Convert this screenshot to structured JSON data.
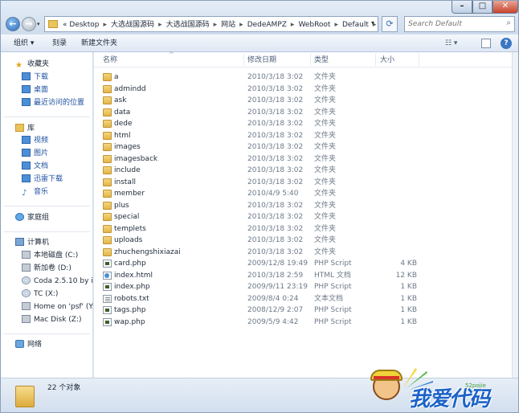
{
  "address": {
    "crumbs": [
      "«",
      "Desktop",
      "大选战国源码",
      "大选战国源码",
      "网站",
      "DedeAMPZ",
      "WebRoot",
      "Default"
    ],
    "search_placeholder": "Search Default"
  },
  "toolbar": {
    "organize": "组织 ▾",
    "burn": "刻录",
    "new_folder": "新建文件夹"
  },
  "nav": {
    "favorites": "收藏夹",
    "fav_items": [
      "下载",
      "桌面",
      "最近访问的位置"
    ],
    "libraries": "库",
    "lib_items": [
      "视频",
      "图片",
      "文档",
      "迅雷下载",
      "音乐"
    ],
    "homegroup": "家庭组",
    "computer": "计算机",
    "computer_items": [
      "本地磁盘 (C:)",
      "新加卷 (D:)",
      "Coda 2.5.10 by itsu",
      "TC (X:)",
      "Home on 'psf' (Y:)",
      "Mac Disk (Z:)"
    ],
    "network": "网络"
  },
  "columns": {
    "name": "名称",
    "date": "修改日期",
    "type": "类型",
    "size": "大小"
  },
  "files": [
    {
      "name": "a",
      "date": "2010/3/18 3:02",
      "type": "文件夹",
      "size": "",
      "icon": "folder"
    },
    {
      "name": "admindd",
      "date": "2010/3/18 3:02",
      "type": "文件夹",
      "size": "",
      "icon": "folder"
    },
    {
      "name": "ask",
      "date": "2010/3/18 3:02",
      "type": "文件夹",
      "size": "",
      "icon": "folder"
    },
    {
      "name": "data",
      "date": "2010/3/18 3:02",
      "type": "文件夹",
      "size": "",
      "icon": "folder"
    },
    {
      "name": "dede",
      "date": "2010/3/18 3:02",
      "type": "文件夹",
      "size": "",
      "icon": "folder"
    },
    {
      "name": "html",
      "date": "2010/3/18 3:02",
      "type": "文件夹",
      "size": "",
      "icon": "folder"
    },
    {
      "name": "images",
      "date": "2010/3/18 3:02",
      "type": "文件夹",
      "size": "",
      "icon": "folder"
    },
    {
      "name": "imagesback",
      "date": "2010/3/18 3:02",
      "type": "文件夹",
      "size": "",
      "icon": "folder"
    },
    {
      "name": "include",
      "date": "2010/3/18 3:02",
      "type": "文件夹",
      "size": "",
      "icon": "folder"
    },
    {
      "name": "install",
      "date": "2010/3/18 3:02",
      "type": "文件夹",
      "size": "",
      "icon": "folder"
    },
    {
      "name": "member",
      "date": "2010/4/9 5:40",
      "type": "文件夹",
      "size": "",
      "icon": "folder"
    },
    {
      "name": "plus",
      "date": "2010/3/18 3:02",
      "type": "文件夹",
      "size": "",
      "icon": "folder"
    },
    {
      "name": "special",
      "date": "2010/3/18 3:02",
      "type": "文件夹",
      "size": "",
      "icon": "folder"
    },
    {
      "name": "templets",
      "date": "2010/3/18 3:02",
      "type": "文件夹",
      "size": "",
      "icon": "folder"
    },
    {
      "name": "uploads",
      "date": "2010/3/18 3:02",
      "type": "文件夹",
      "size": "",
      "icon": "folder"
    },
    {
      "name": "zhuchengshixiazai",
      "date": "2010/3/18 3:02",
      "type": "文件夹",
      "size": "",
      "icon": "folder"
    },
    {
      "name": "card.php",
      "date": "2009/12/8 19:49",
      "type": "PHP Script",
      "size": "4 KB",
      "icon": "php"
    },
    {
      "name": "index.html",
      "date": "2010/3/18 2:59",
      "type": "HTML 文档",
      "size": "12 KB",
      "icon": "html"
    },
    {
      "name": "index.php",
      "date": "2009/9/11 23:19",
      "type": "PHP Script",
      "size": "1 KB",
      "icon": "php"
    },
    {
      "name": "robots.txt",
      "date": "2009/8/4 0:24",
      "type": "文本文档",
      "size": "1 KB",
      "icon": "txt"
    },
    {
      "name": "tags.php",
      "date": "2008/12/9 2:07",
      "type": "PHP Script",
      "size": "1 KB",
      "icon": "php"
    },
    {
      "name": "wap.php",
      "date": "2009/5/9 4:42",
      "type": "PHP Script",
      "size": "1 KB",
      "icon": "php"
    }
  ],
  "status": {
    "count": "22 个对象"
  },
  "watermark": {
    "text": "我爱代码",
    "small": "52pojie"
  }
}
